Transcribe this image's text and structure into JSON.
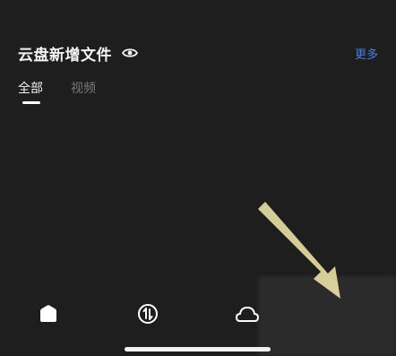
{
  "section": {
    "title": "云盘新增文件",
    "more_label": "更多",
    "eye_icon": "eye-icon"
  },
  "tabs": [
    {
      "label": "全部",
      "active": true
    },
    {
      "label": "视频",
      "active": false
    }
  ],
  "bottom_nav": {
    "items": [
      {
        "icon": "home-icon"
      },
      {
        "icon": "transfer-icon"
      },
      {
        "icon": "cloud-icon"
      }
    ]
  },
  "colors": {
    "background": "#1e1e1f",
    "accent": "#4b7de6",
    "text_primary": "#f2f2f2",
    "text_secondary": "#7a7a7a",
    "arrow": "#eadfa4"
  }
}
